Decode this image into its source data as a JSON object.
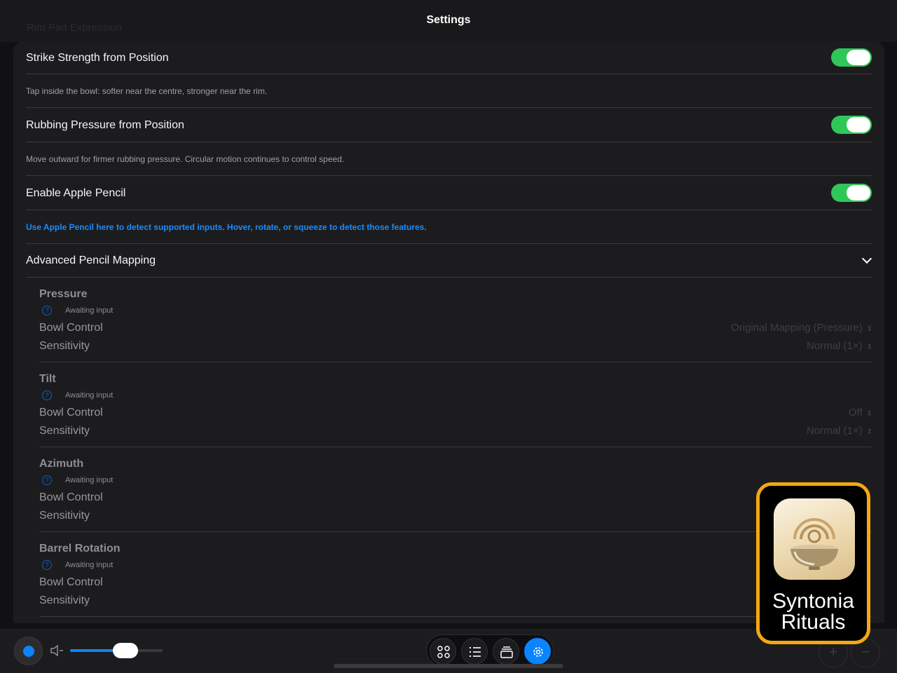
{
  "header": {
    "title": "Settings",
    "behind_title": "Rim Pad Expression"
  },
  "settings": {
    "strike": {
      "label": "Strike Strength from Position",
      "description": "Tap inside the bowl: softer near the centre, stronger near the rim.",
      "enabled": true
    },
    "rubbing": {
      "label": "Rubbing Pressure from Position",
      "description": "Move outward for firmer rubbing pressure. Circular motion continues to control speed.",
      "enabled": true
    },
    "pencil": {
      "label": "Enable Apple Pencil",
      "description": "Use Apple Pencil here to detect supported inputs. Hover, rotate, or squeeze to detect those features.",
      "enabled": true
    },
    "advanced": {
      "label": "Advanced Pencil Mapping",
      "expanded": true
    }
  },
  "mappings": [
    {
      "title": "Pressure",
      "status": "Awaiting input",
      "bowl_label": "Bowl Control",
      "bowl_value": "Original Mapping (Pressure)",
      "sens_label": "Sensitivity",
      "sens_value": "Normal (1×)"
    },
    {
      "title": "Tilt",
      "status": "Awaiting input",
      "bowl_label": "Bowl Control",
      "bowl_value": "Off",
      "sens_label": "Sensitivity",
      "sens_value": "Normal (1×)"
    },
    {
      "title": "Azimuth",
      "status": "Awaiting input",
      "bowl_label": "Bowl Control",
      "sens_label": "Sensitivity"
    },
    {
      "title": "Barrel Rotation",
      "status": "Awaiting input",
      "bowl_label": "Bowl Control",
      "sens_label": "Sensitivity"
    }
  ],
  "bottom": {
    "volume_level": 0.6,
    "zoom_in": "+",
    "zoom_out": "−",
    "active_tab": "settings"
  },
  "overlay": {
    "app_name_line1": "Syntonia",
    "app_name_line2": "Rituals"
  },
  "colors": {
    "accent": "#0a84ff",
    "toggle_on": "#30c759",
    "badge_border": "#f3a712",
    "link": "#1a8cff"
  }
}
